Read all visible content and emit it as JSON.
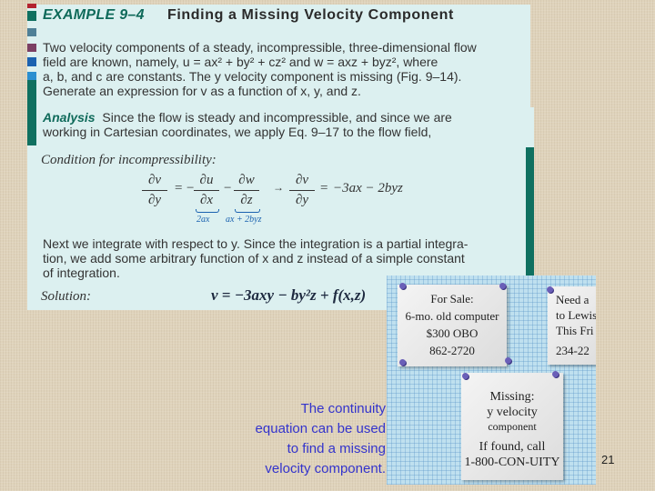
{
  "example": {
    "number_label": "EXAMPLE 9–4",
    "title": "Finding a Missing Velocity Component",
    "problem_lines": [
      "Two velocity components of a steady, incompressible, three-dimensional flow",
      "field are known, namely, u = ax² + by² + cz² and w = axz + byz², where",
      "a, b, and c are constants. The y velocity component is missing (Fig. 9–14).",
      "Generate an expression for v as a function of x, y, and z."
    ],
    "analysis_label": "Analysis",
    "analysis_lines": [
      "Since the flow is steady and incompressible, and since we are",
      "working in Cartesian coordinates, we apply Eq. 9–17 to the flow field,"
    ],
    "condition_label": "Condition for incompressibility:",
    "equation": {
      "lhs_num": "∂v",
      "lhs_den": "∂y",
      "eq1": "=",
      "neg": "−",
      "t1_num": "∂u",
      "t1_den": "∂x",
      "minus": "−",
      "t2_num": "∂w",
      "t2_den": "∂z",
      "arrow": "→",
      "r_num": "∂v",
      "r_den": "∂y",
      "eq2": "=",
      "rhs": "−3ax − 2byz",
      "brace1": "2ax",
      "brace2": "ax + 2byz"
    },
    "integration_lines": [
      "Next we integrate with respect to y. Since the integration is a partial integra-",
      "tion, we add some arbitrary function of x and z instead of a simple constant",
      "of integration."
    ],
    "solution_label": "Solution:",
    "solution_equation": "v = −3axy − by²z + f(x,z)"
  },
  "figure": {
    "note_for_sale": [
      "For Sale:",
      "6-mo. old computer",
      "$300 OBO",
      "862-2720"
    ],
    "note_ride": [
      "Need a",
      "to Lewis",
      "This Fri",
      "234-22"
    ],
    "note_missing": [
      "Missing:",
      "y velocity",
      "component",
      "If found, call",
      "1-800-CON-UITY"
    ]
  },
  "caption_lines": [
    "The continuity",
    "equation can be used",
    "to find a missing",
    "velocity component."
  ],
  "page_number": "21",
  "colors": {
    "accent_teal": "#0f7060",
    "box_background": "#dcf0f0",
    "caption_blue": "#3333cc"
  }
}
